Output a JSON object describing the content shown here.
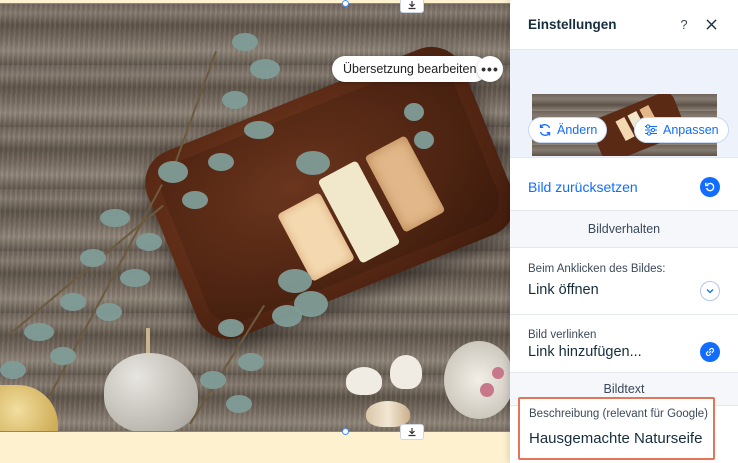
{
  "editor": {
    "edit_translation_label": "Übersetzung bearbeiten",
    "more_label": "•••",
    "selection_color": "#4d8df5"
  },
  "panel": {
    "title": "Einstellungen",
    "help_label": "?",
    "change_label": "Ändern",
    "adjust_label": "Anpassen",
    "reset_label": "Bild zurücksetzen",
    "section_behavior": "Bildverhalten",
    "click_label": "Beim Anklicken des Bildes:",
    "click_value": "Link öffnen",
    "link_label": "Bild verlinken",
    "link_value": "Link hinzufügen...",
    "section_text": "Bildtext",
    "description_label": "Beschreibung (relevant für Google)",
    "description_value": "Hausgemachte Naturseife",
    "accent_color": "#116dff",
    "highlight_color": "#e47559"
  }
}
